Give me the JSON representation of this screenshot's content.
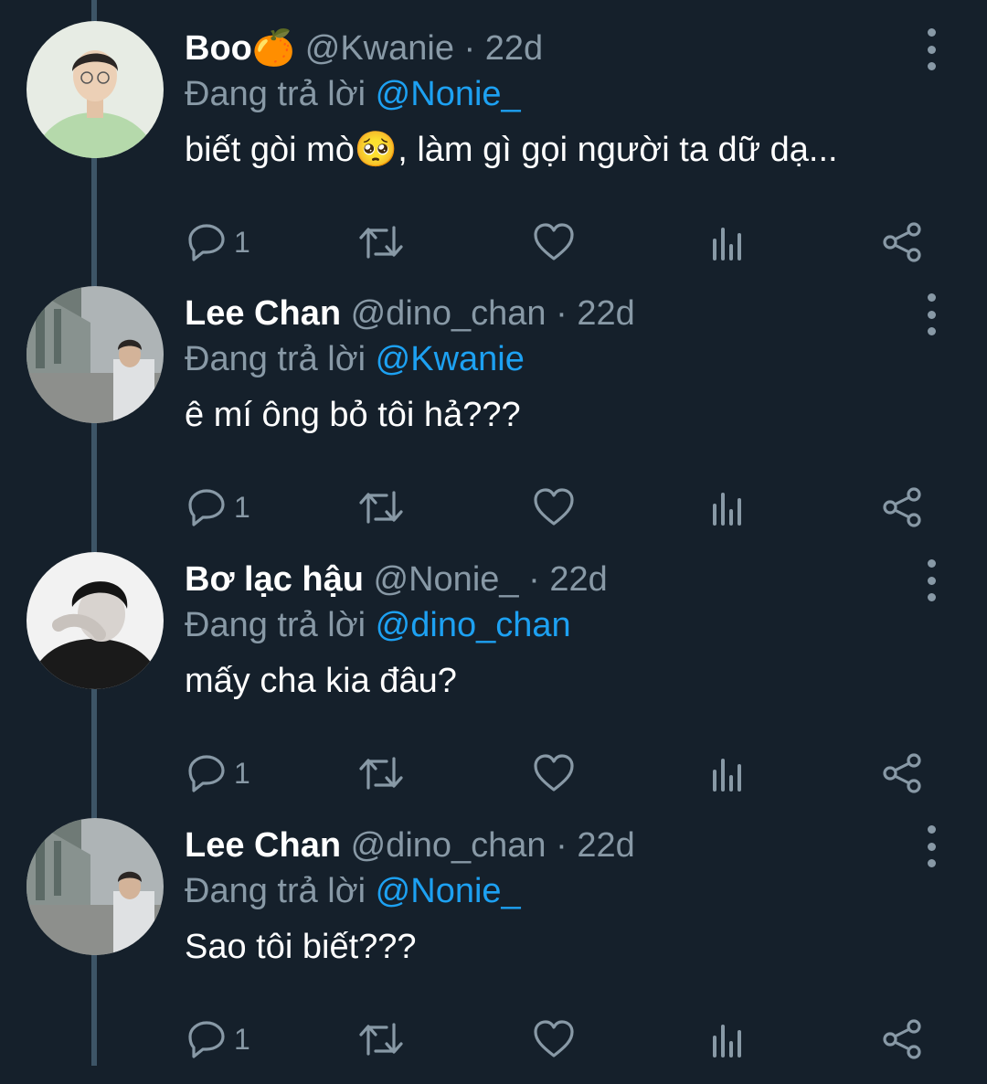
{
  "colors": {
    "background": "#15202b",
    "text": "#ffffff",
    "muted": "#8899a6",
    "accent": "#1da1f2",
    "thread_line": "#3d5466"
  },
  "reply_prefix": "Đang trả lời",
  "icons": [
    "reply-icon",
    "retweet-icon",
    "like-icon",
    "analytics-icon",
    "share-icon",
    "more-icon"
  ],
  "tweets": [
    {
      "name": "Boo",
      "name_emoji": "🍊",
      "handle": "@Kwanie",
      "separator": "·",
      "time": "22d",
      "replying_to": "@Nonie_",
      "text_before": "biết gòi mò",
      "text_emoji": "🥺",
      "text_after": ", làm gì gọi người ta dữ dạ...",
      "reply_count": "1"
    },
    {
      "name": "Lee Chan",
      "name_emoji": "",
      "handle": "@dino_chan",
      "separator": "·",
      "time": "22d",
      "replying_to": "@Kwanie",
      "text_before": "ê mí ông bỏ tôi hả???",
      "text_emoji": "",
      "text_after": "",
      "reply_count": "1"
    },
    {
      "name": "Bơ lạc hậu",
      "name_emoji": "",
      "handle": "@Nonie_",
      "separator": "·",
      "time": "22d",
      "replying_to": "@dino_chan",
      "text_before": "mấy cha kia đâu?",
      "text_emoji": "",
      "text_after": "",
      "reply_count": "1"
    },
    {
      "name": "Lee Chan",
      "name_emoji": "",
      "handle": "@dino_chan",
      "separator": "·",
      "time": "22d",
      "replying_to": "@Nonie_",
      "text_before": "Sao tôi biết???",
      "text_emoji": "",
      "text_after": "",
      "reply_count": "1"
    }
  ]
}
